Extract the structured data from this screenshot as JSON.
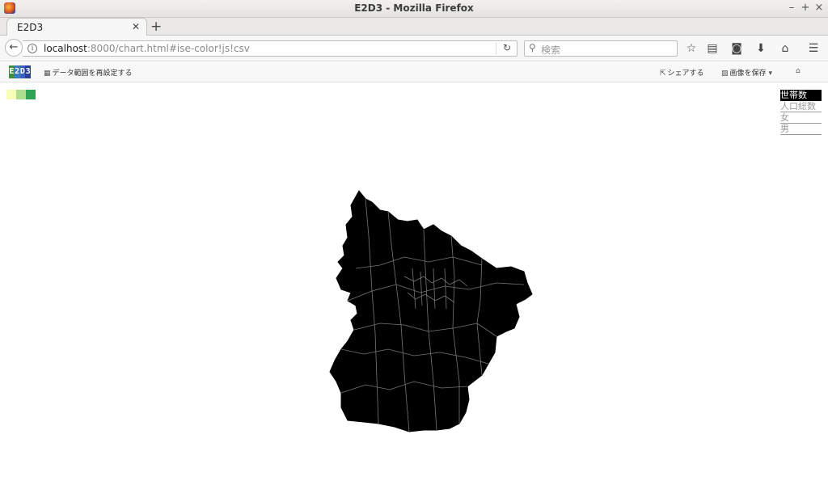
{
  "window": {
    "title": "E2D3 - Mozilla Firefox"
  },
  "tabs": [
    {
      "label": "E2D3"
    }
  ],
  "navbar": {
    "url_host": "localhost",
    "url_rest": ":8000/chart.html#ise-color!js!csv",
    "search_placeholder": "検索"
  },
  "app_toolbar": {
    "logo": [
      "E",
      "2",
      "D",
      "3"
    ],
    "reset_range_label": "データ範囲を再設定する",
    "share_label": "シェアする",
    "save_image_label": "画像を保存"
  },
  "legend": {
    "colors": [
      "#f7fcb9",
      "#addd8e",
      "#31a354"
    ]
  },
  "menu": {
    "items": [
      "世帯数",
      "人口総数",
      "女",
      "男"
    ],
    "selected": "世帯数"
  },
  "map": {
    "fill": "#000000",
    "border_color": "#777777"
  },
  "icons": {
    "back": "back-arrow-icon",
    "info": "info-icon",
    "reload": "reload-icon",
    "search": "search-icon",
    "bookmark": "star-icon",
    "reading_list": "reading-list-icon",
    "pocket": "pocket-icon",
    "downloads": "download-icon",
    "home": "home-icon",
    "menu": "hamburger-menu-icon"
  }
}
